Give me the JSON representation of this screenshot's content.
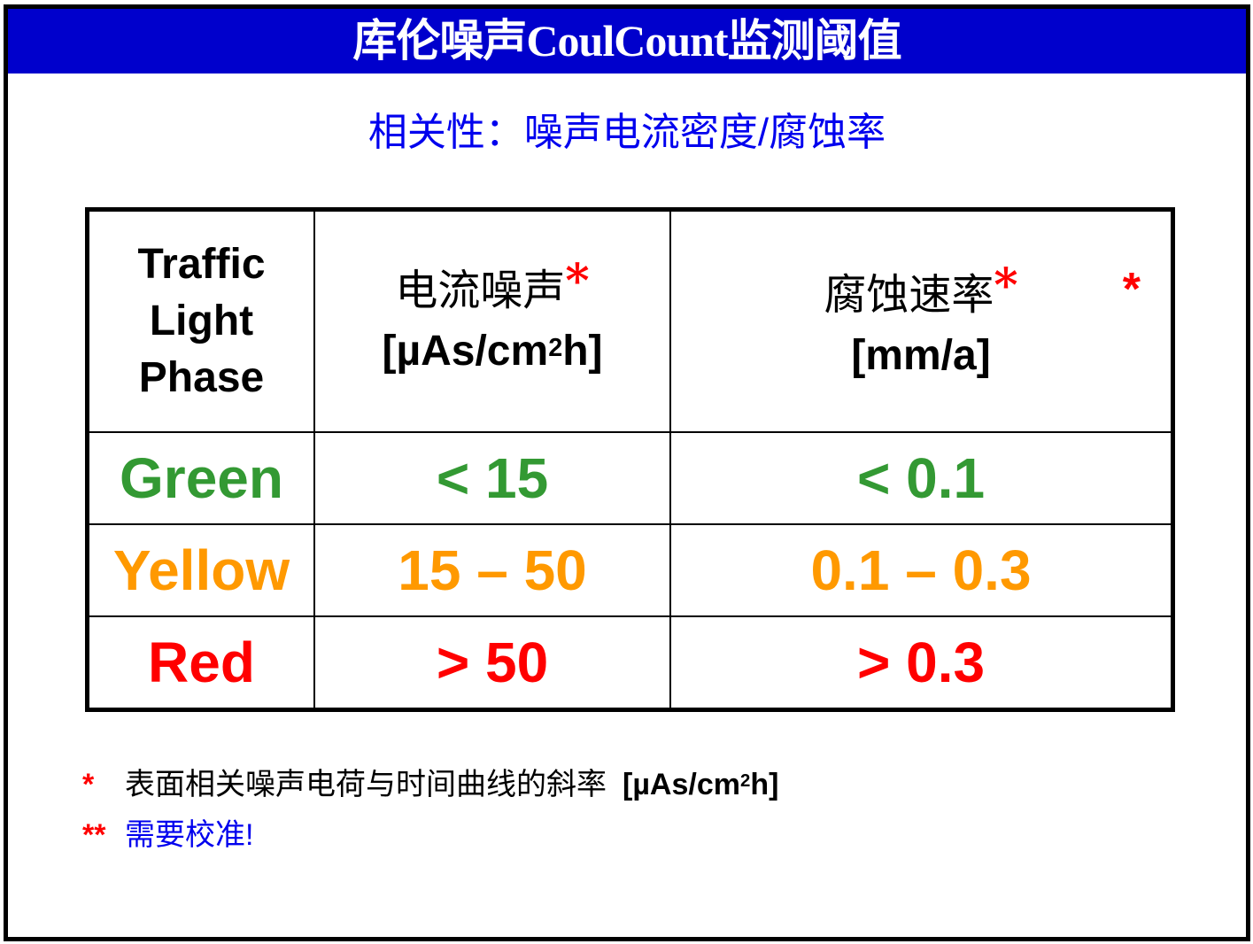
{
  "header": {
    "title": "库伦噪声CoulCount监测阈值"
  },
  "subtitle": "相关性：噪声电流密度/腐蚀率",
  "table": {
    "columns": [
      {
        "label_lines": [
          "Traffic",
          "Light",
          "Phase"
        ]
      },
      {
        "label": "电流噪声",
        "marker": "*",
        "unit_prefix": "[µAs/cm",
        "unit_sup": "2",
        "unit_suffix": "h]"
      },
      {
        "label": "腐蚀速率",
        "marker": "*",
        "extra_marker": "*",
        "unit": "[mm/a]"
      }
    ],
    "rows": [
      {
        "phase": "Green",
        "noise": "< 15",
        "corrosion": "< 0.1",
        "color": "#339933"
      },
      {
        "phase": "Yellow",
        "noise": "15 – 50",
        "corrosion": "0.1 – 0.3",
        "color": "#ff9900"
      },
      {
        "phase": "Red",
        "noise": "> 50",
        "corrosion": "> 0.3",
        "color": "#ff0000"
      }
    ]
  },
  "notes": [
    {
      "mark": "*",
      "text": "表面相关噪声电荷与时间曲线的斜率",
      "unit_prefix": "[µAs/cm",
      "unit_sup": "2",
      "unit_suffix": "h]"
    },
    {
      "mark": "**",
      "text": "需要校准!"
    }
  ],
  "colors": {
    "banner": "#0000cc",
    "subtitle": "#0000ee",
    "green": "#339933",
    "yellow": "#ff9900",
    "red": "#ff0000"
  }
}
